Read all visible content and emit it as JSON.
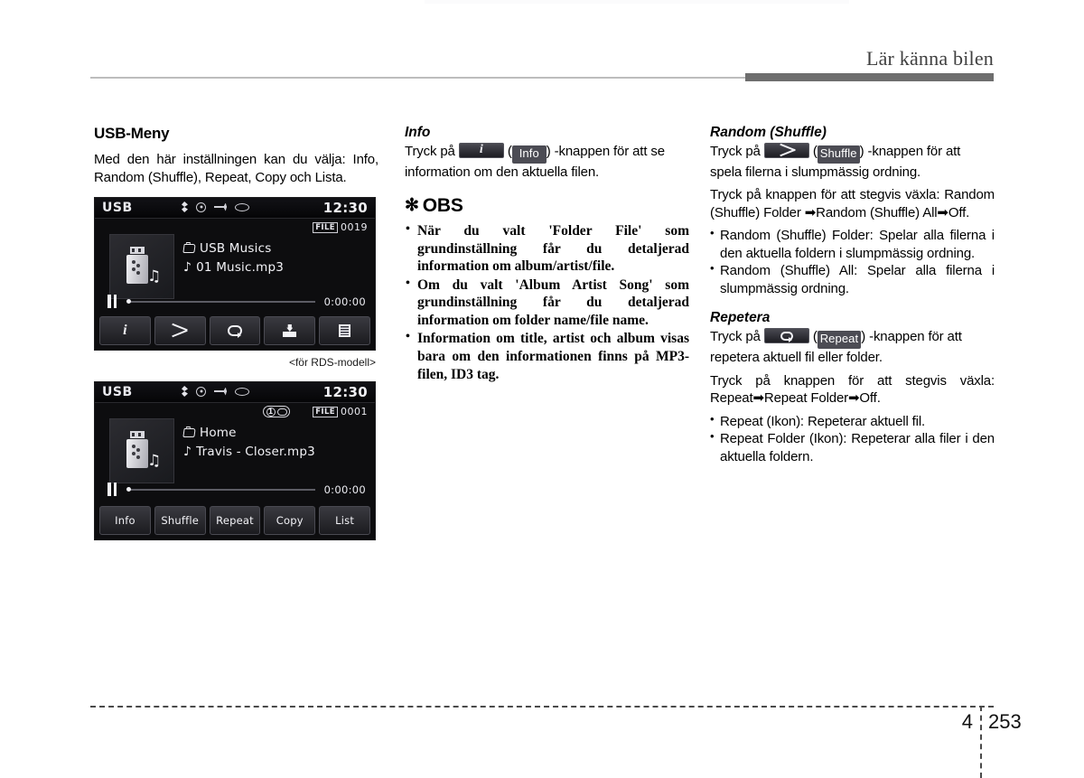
{
  "header": {
    "title": "Lär känna bilen"
  },
  "footer": {
    "chapter": "4",
    "page": "253"
  },
  "col1": {
    "heading": "USB-Meny",
    "intro": "Med den här inställningen kan du välja: Info, Random (Shuffle), Repeat, Copy och Lista.",
    "caption": "<för RDS-modell>"
  },
  "screen1": {
    "source": "USB",
    "time": "12:30",
    "file_label": "FILE",
    "file_number": "0019",
    "folder": "USB Musics",
    "track": "01 Music.mp3",
    "elapsed": "0:00:00",
    "buttons": [
      "info-icon",
      "shuffle-icon",
      "repeat-icon",
      "copy-icon",
      "list-icon"
    ]
  },
  "screen2": {
    "source": "USB",
    "time": "12:30",
    "repeat_one_badge": "1",
    "file_label": "FILE",
    "file_number": "0001",
    "folder": "Home",
    "track": "Travis - Closer.mp3",
    "elapsed": "0:00:00",
    "buttons": [
      "Info",
      "Shuffle",
      "Repeat",
      "Copy",
      "List"
    ]
  },
  "col2": {
    "info_heading": "Info",
    "info_pre": "Tryck på",
    "info_paren_open": "(",
    "info_pill": "Info",
    "info_paren_close": ")",
    "info_post": "-knappen för att se information om den aktuella filen.",
    "obs_star": "✻",
    "obs_heading": "OBS",
    "obs_items": [
      "När du valt 'Folder File' som grundinställning får du detaljerad information om album/artist/file.",
      "Om du valt 'Album Artist Song' som grundinställning får du detaljerad information om folder name/file name.",
      "Information om title, artist och album visas bara om den informationen finns på MP3-filen, ID3 tag."
    ]
  },
  "col3": {
    "random_heading": "Random (Shuffle)",
    "random_pre": "Tryck på",
    "random_paren_open": "(",
    "random_pill": "Shuffle",
    "random_paren_close": ")",
    "random_post": "-knappen för att spela filerna i slumpmässig ordning.",
    "random_cycle": "Tryck på knappen för att stegvis växla: Random (Shuffle) Folder ➡Random (Shuffle) All➡Off.",
    "random_items": [
      "Random (Shuffle) Folder: Spelar alla filerna i den aktuella foldern i slumpmässig ordning.",
      "Random (Shuffle) All: Spelar alla filerna i slumpmässig ordning."
    ],
    "repeat_heading": "Repetera",
    "repeat_pre": "Tryck på",
    "repeat_paren_open": "(",
    "repeat_pill": "Repeat",
    "repeat_paren_close": ")",
    "repeat_post": "-knappen för att repetera aktuell fil eller folder.",
    "repeat_cycle": "Tryck på knappen för att stegvis växla: Repeat➡Repeat Folder➡Off.",
    "repeat_items": [
      "Repeat (Ikon): Repeterar aktuell fil.",
      "Repeat Folder (Ikon): Repeterar alla filer i den aktuella foldern."
    ]
  }
}
